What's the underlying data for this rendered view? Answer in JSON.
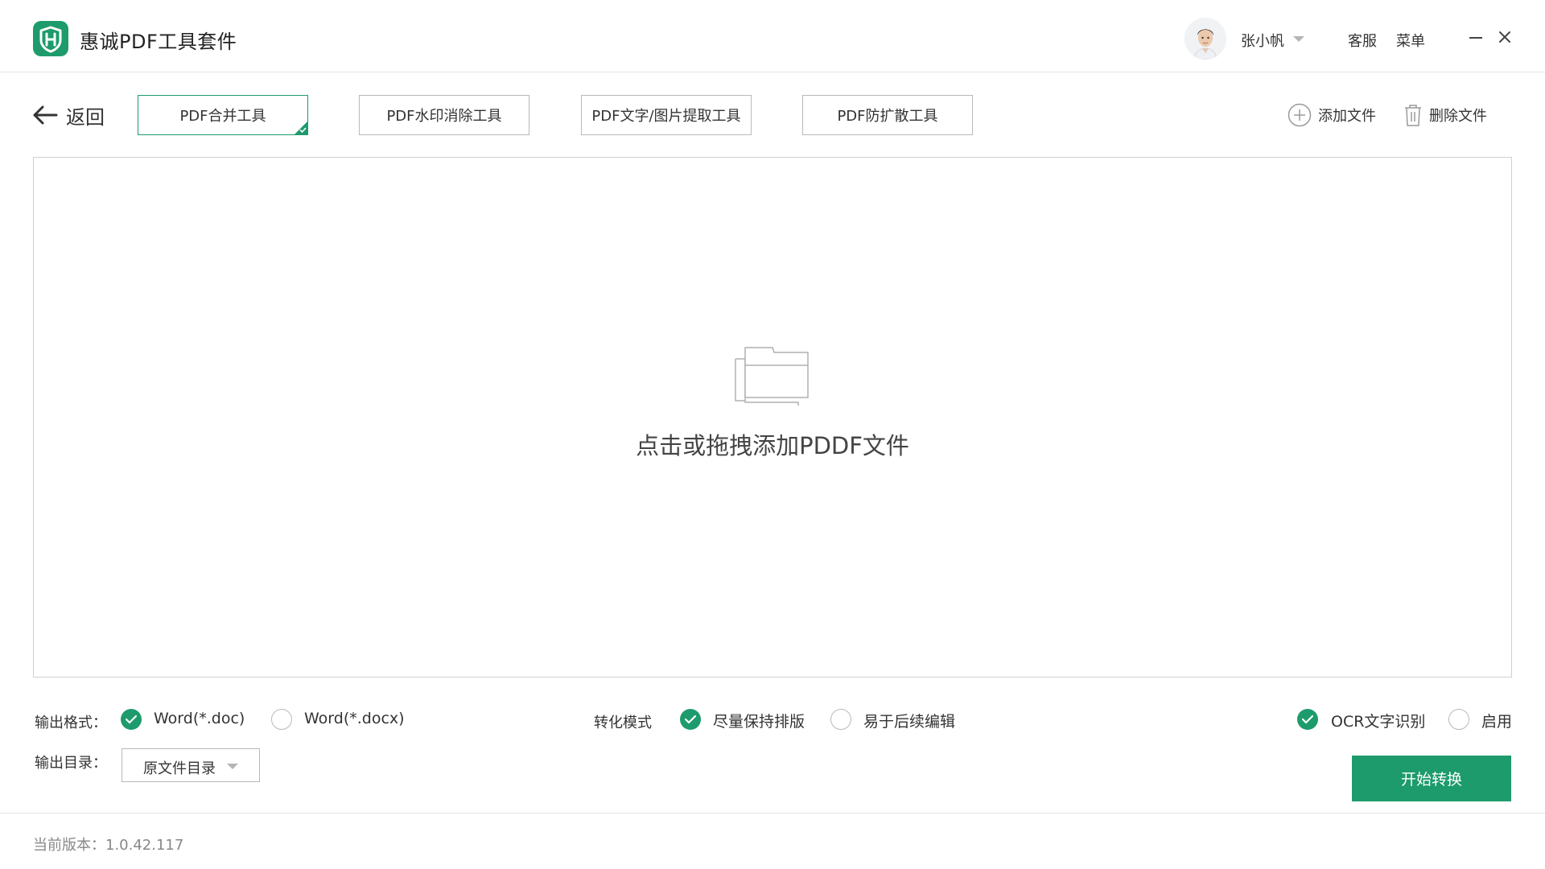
{
  "app": {
    "title": "惠诚PDF工具套件"
  },
  "user": {
    "name": "张小帆"
  },
  "titlebar": {
    "service_label": "客服",
    "menu_label": "菜单"
  },
  "toolbar": {
    "back_label": "返回",
    "tabs": [
      {
        "label": "PDF合并工具",
        "active": true
      },
      {
        "label": "PDF水印消除工具",
        "active": false
      },
      {
        "label": "PDF文字/图片提取工具",
        "active": false
      },
      {
        "label": "PDF防扩散工具",
        "active": false
      }
    ],
    "add_file_label": "添加文件",
    "delete_file_label": "删除文件"
  },
  "dropzone": {
    "prompt": "点击或拖拽添加PDDF文件"
  },
  "options": {
    "output_format_label": "输出格式：",
    "output_formats": [
      {
        "label": "Word(*.doc)",
        "checked": true
      },
      {
        "label": "Word(*.docx)",
        "checked": false
      }
    ],
    "convert_mode_label": "转化模式",
    "convert_modes": [
      {
        "label": "尽量保持排版",
        "checked": true
      },
      {
        "label": "易于后续编辑",
        "checked": false
      }
    ],
    "ocr": [
      {
        "label": "OCR文字识别",
        "checked": true
      },
      {
        "label": "启用",
        "checked": false
      }
    ],
    "output_dir_label": "输出目录：",
    "output_dir_value": "原文件目录"
  },
  "actions": {
    "start_label": "开始转换"
  },
  "footer": {
    "version_text": "当前版本：1.0.42.117"
  },
  "colors": {
    "accent": "#1d9b6c",
    "border": "#b9b9b9",
    "text": "#333333",
    "muted": "#888888"
  }
}
